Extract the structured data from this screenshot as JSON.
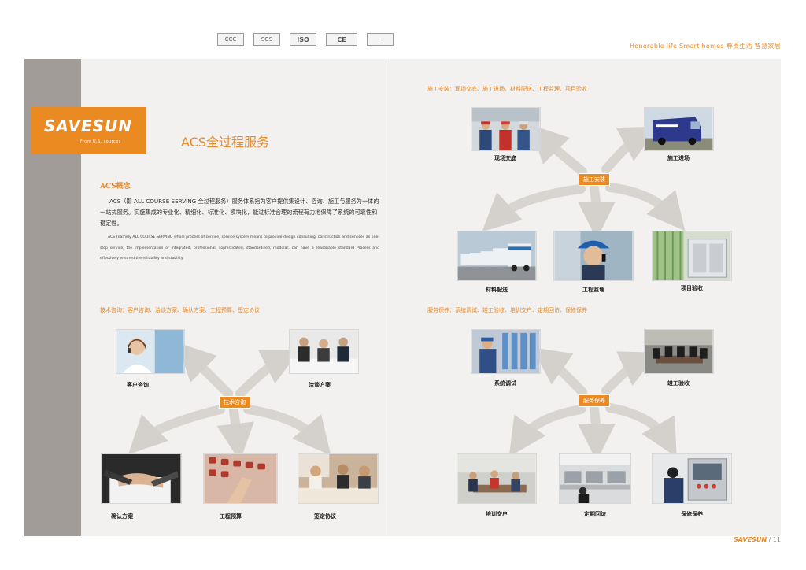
{
  "header": {
    "certifications": [
      {
        "name": "cert-mark-1",
        "label": "CCC"
      },
      {
        "name": "cert-mark-2",
        "label": "SGS"
      },
      {
        "name": "cert-mark-3",
        "label": "ISO"
      },
      {
        "name": "cert-mark-4",
        "label": "CE"
      },
      {
        "name": "cert-mark-5",
        "label": "~"
      }
    ],
    "tagline": "Honorable life  Smart homes  尊贵生活  智慧家居"
  },
  "logo": {
    "brand": "SAVESUN",
    "sub": "From U.S. sources"
  },
  "main_title": "ACS全过程服务",
  "concept": {
    "title": "ACS概念",
    "cn": "ACS（即 ALL COURSE SERVING 全过程服务）服务体系指为客户提供集设计、咨询、施工与服务为一体的一站式服务。实施集成的专业化、精细化、标准化、模块化，能过标准合理的流程有力地保障了系统的可靠性和稳定性。",
    "en": "ACS (namely ALL COURSE SERVING whole process of service) service system means to provide design consulting, construction and services as one-stop service, the implementation of integrated, professional, sophisticated, standardized, modular, can have a reasonable standard Process and effectively ensured the reliability and stability."
  },
  "sections": {
    "consult": {
      "label": "技术咨询：客户咨询、洽谈方案、确认方案、工程预算、签定协议",
      "hub": "技术咨询",
      "items": [
        "客户咨询",
        "洽谈方案",
        "确认方案",
        "工程预算",
        "签定协议"
      ]
    },
    "install": {
      "label": "施工安装：现场交底、施工进场、材料配送、工程监理、项目验收",
      "hub": "施工安装",
      "items": [
        "现场交底",
        "施工进场",
        "材料配送",
        "工程监理",
        "项目验收"
      ]
    },
    "service": {
      "label": "服务保养：系统调试、竣工验收、培训交户、定期回访、保修保养",
      "hub": "服务保养",
      "items": [
        "系统调试",
        "竣工验收",
        "培训交户",
        "定期回访",
        "保修保养"
      ]
    }
  },
  "footer": {
    "brand": "SAVESUN",
    "page": " / 11"
  },
  "colors": {
    "accent": "#ec8a22",
    "panel": "#f3f1ef",
    "stripe": "#a19c98"
  }
}
